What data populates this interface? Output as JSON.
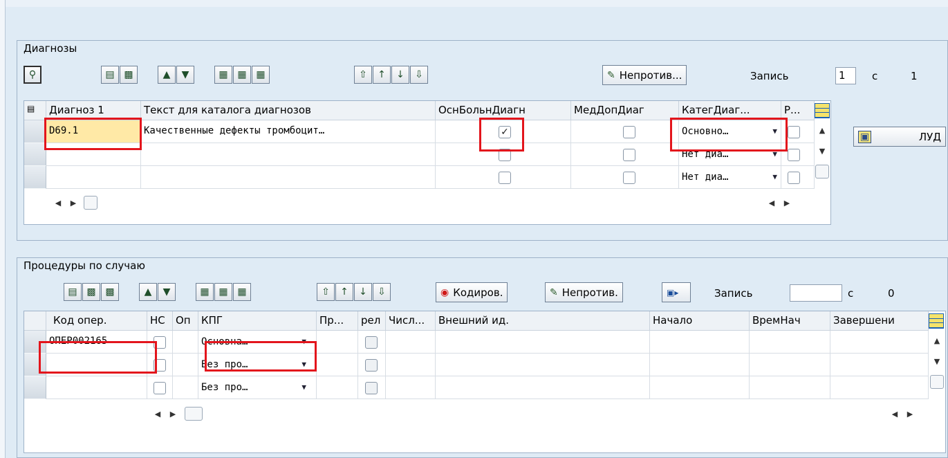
{
  "diagnoses": {
    "title": "Диагнозы",
    "toolbar": {
      "nonconflict_label": "Непротив...",
      "record_label": "Запись",
      "record_value": "1",
      "of_label": "с",
      "total": "1"
    },
    "lud_label": "ЛУД",
    "columns": [
      "Диагноз 1",
      "Текст для каталога диагнозов",
      "ОснБольнДиагн",
      "МедДопДиаг",
      "КатегДиаг...",
      "Р..."
    ],
    "rows": [
      {
        "code": "D69.1",
        "text": "Качественные дефекты тромбоцит…",
        "main": true,
        "med": false,
        "category": "Основно…"
      },
      {
        "code": "",
        "text": "",
        "main": false,
        "med": false,
        "category": "Нет диа…"
      },
      {
        "code": "",
        "text": "",
        "main": false,
        "med": false,
        "category": "Нет диа…"
      }
    ]
  },
  "procedures": {
    "title": "Процедуры по случаю",
    "toolbar": {
      "coding_label": "Кодиров.",
      "nonconflict_label": "Непротив.",
      "record_label": "Запись",
      "record_value": "",
      "of_label": "с",
      "total": "0"
    },
    "columns": [
      "Код опер.",
      "НС",
      "Оп",
      "КПГ",
      "Пр...",
      "рел",
      "Числ...",
      "Внешний ид.",
      "Начало",
      "ВремНач",
      "Завершени"
    ],
    "rows": [
      {
        "code": "ОПЕР002165",
        "kpg": "Основна…"
      },
      {
        "code": "",
        "kpg": "Без про…"
      },
      {
        "code": "",
        "kpg": "Без про…"
      }
    ]
  },
  "icons": [
    "details-icon",
    "insert-row-icon",
    "delete-row-icon",
    "sort-icon",
    "filter-icon",
    "first-page-icon",
    "prev-page-icon",
    "next-page-icon",
    "last-page-icon",
    "scroll-left-icon",
    "scroll-right-icon",
    "scroll-up-icon",
    "scroll-down-icon",
    "table-settings-icon",
    "target-icon"
  ],
  "colors": {
    "highlight": "#e3151c",
    "input_required": "#ffe9a6",
    "panel": "#dfebf5"
  }
}
